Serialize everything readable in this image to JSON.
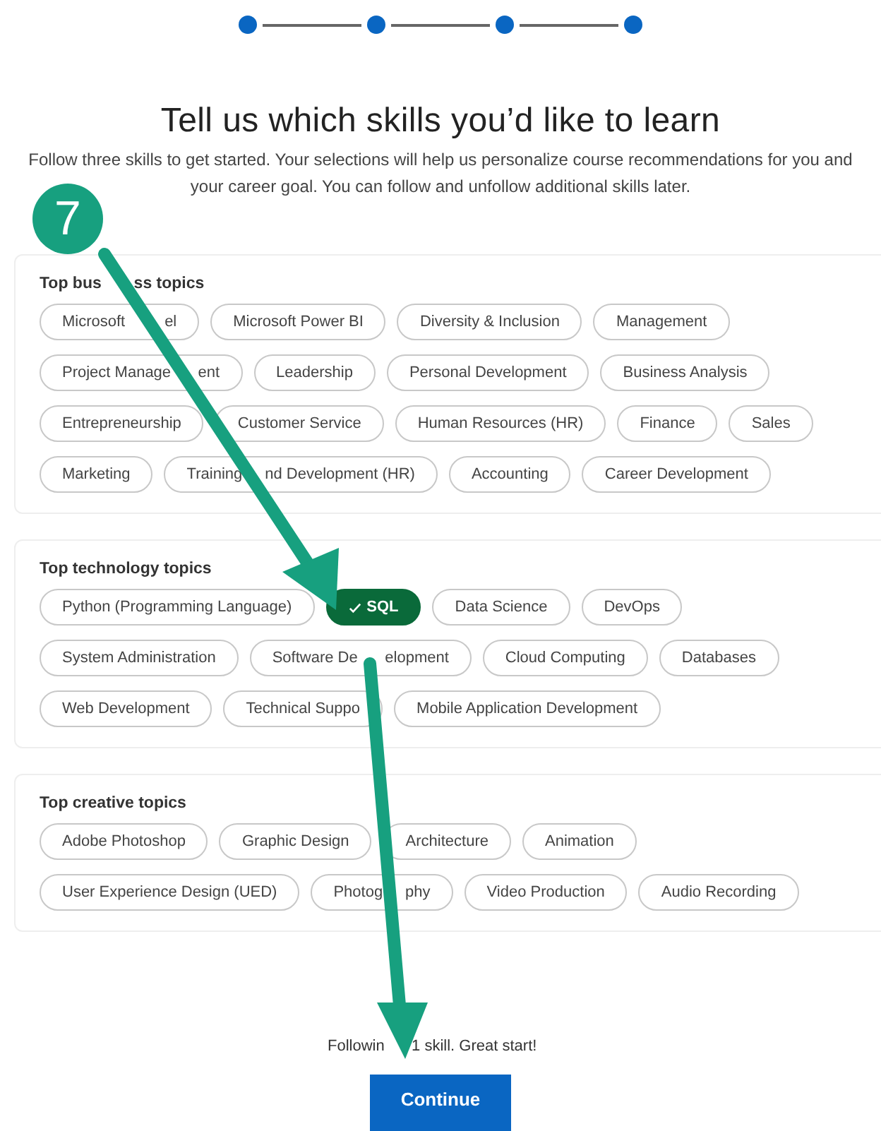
{
  "title": "Tell us which skills you’d like to learn",
  "subtitle": "Follow three skills to get started. Your selections will help us personalize course recommendations for you and your career goal. You can follow and unfollow additional skills later.",
  "step_badge": "7",
  "sections": [
    {
      "heading": "Top bus",
      "heading_tail": "ss topics",
      "skills": [
        {
          "label": "Microsoft",
          "label_tail": "el",
          "selected": false
        },
        {
          "label": "Microsoft Power BI",
          "selected": false
        },
        {
          "label": "Diversity & Inclusion",
          "selected": false
        },
        {
          "label": "Management",
          "selected": false
        },
        {
          "label": "Project Manage",
          "label_tail": "ent",
          "selected": false
        },
        {
          "label": "Leadership",
          "selected": false
        },
        {
          "label": "Personal Development",
          "selected": false
        },
        {
          "label": "Business Analysis",
          "selected": false
        },
        {
          "label": "Entrepreneurship",
          "selected": false
        },
        {
          "label": "Customer Service",
          "selected": false
        },
        {
          "label": "Human Resources (HR)",
          "selected": false
        },
        {
          "label": "Finance",
          "selected": false
        },
        {
          "label": "Sales",
          "selected": false
        },
        {
          "label": "Marketing",
          "selected": false
        },
        {
          "label": "Training",
          "label_tail": "nd Development (HR)",
          "selected": false
        },
        {
          "label": "Accounting",
          "selected": false
        },
        {
          "label": "Career Development",
          "selected": false
        }
      ]
    },
    {
      "heading": "Top technology topics",
      "skills": [
        {
          "label": "Python (Programming Language)",
          "selected": false
        },
        {
          "label": "SQL",
          "selected": true
        },
        {
          "label": "Data Science",
          "selected": false
        },
        {
          "label": "DevOps",
          "selected": false
        },
        {
          "label": "System Administration",
          "selected": false
        },
        {
          "label": "Software De",
          "label_tail": "elopment",
          "selected": false
        },
        {
          "label": "Cloud Computing",
          "selected": false
        },
        {
          "label": "Databases",
          "selected": false
        },
        {
          "label": "Web Development",
          "selected": false
        },
        {
          "label": "Technical Suppo",
          "selected": false
        },
        {
          "label": "Mobile Application Development",
          "selected": false
        }
      ]
    },
    {
      "heading": "Top creative topics",
      "skills": [
        {
          "label": "Adobe Photoshop",
          "selected": false
        },
        {
          "label": "Graphic Design",
          "selected": false
        },
        {
          "label": "Architecture",
          "selected": false
        },
        {
          "label": "Animation",
          "selected": false
        },
        {
          "label": "User Experience Design (UED)",
          "selected": false
        },
        {
          "label": "Photog",
          "label_tail": "phy",
          "selected": false
        },
        {
          "label": "Video Production",
          "selected": false
        },
        {
          "label": "Audio Recording",
          "selected": false
        }
      ]
    }
  ],
  "status": "Followin",
  "status_tail": "1 skill. Great start!",
  "continue_button": "Continue"
}
